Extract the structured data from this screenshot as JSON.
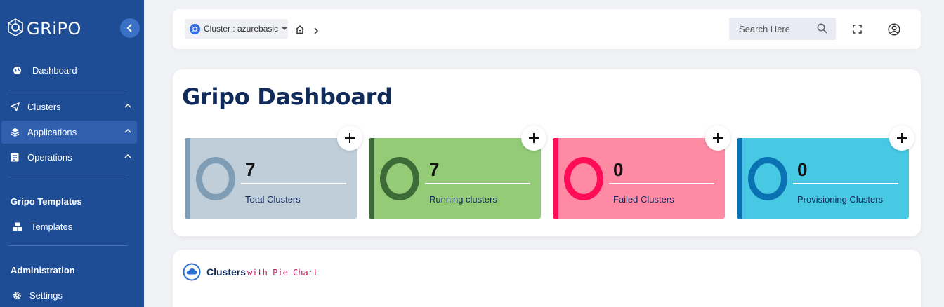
{
  "sidebar": {
    "brand": "GRiPO",
    "items": [
      {
        "label": "Dashboard",
        "icon": "globe-icon"
      },
      {
        "label": "Clusters",
        "icon": "send-icon"
      },
      {
        "label": "Applications",
        "icon": "layers-icon"
      },
      {
        "label": "Operations",
        "icon": "document-icon"
      },
      {
        "label": "Templates",
        "icon": "cubes-icon"
      },
      {
        "label": "Settings",
        "icon": "gear-icon"
      }
    ],
    "sections": {
      "templates": "Gripo Templates",
      "administration": "Administration"
    }
  },
  "topbar": {
    "cluster_select": "Cluster : azurebasic",
    "search_placeholder": "Search Here"
  },
  "dashboard": {
    "title": "Gripo Dashboard",
    "stats": [
      {
        "value": "7",
        "label": "Total Clusters",
        "bg": "#c0ceda",
        "accent": "#7f9db5"
      },
      {
        "value": "7",
        "label": "Running clusters",
        "bg": "#93cb77",
        "accent": "#3d6b37"
      },
      {
        "value": "0",
        "label": "Failed Clusters",
        "bg": "#ff8aa3",
        "accent": "#ff0d56"
      },
      {
        "value": "0",
        "label": "Provisioning Clusters",
        "bg": "#47c8e3",
        "accent": "#0a72b3"
      }
    ]
  },
  "clusters_section": {
    "title": "Clusters",
    "subtitle": "with Pie Chart"
  }
}
